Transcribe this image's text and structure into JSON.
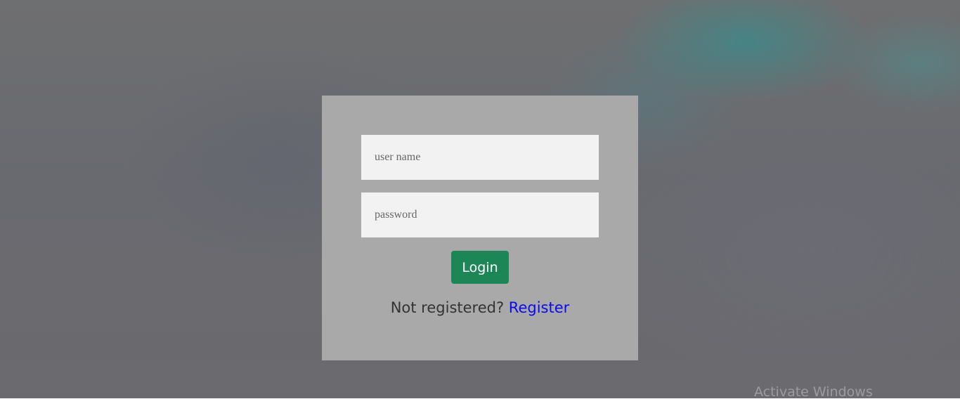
{
  "login_form": {
    "username_placeholder": "user name",
    "password_placeholder": "password",
    "login_label": "Login",
    "register_prompt": "Not registered?",
    "register_link": "Register"
  },
  "overlay": {
    "watermark": "Activate Windows"
  },
  "colors": {
    "card_background": "#a9a9a9",
    "input_background": "#f2f2f2",
    "login_button": "#1c8656",
    "link": "#0a0aee"
  }
}
